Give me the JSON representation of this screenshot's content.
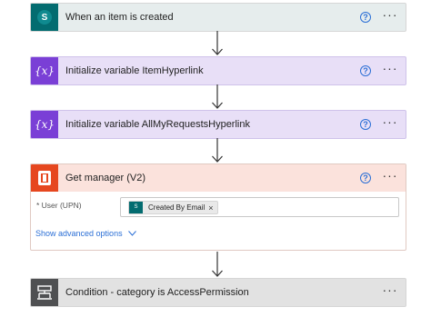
{
  "steps": [
    {
      "id": "trigger",
      "title": "When an item is created",
      "icon": "sharepoint-icon",
      "icon_letter": "S",
      "help": "?",
      "more": "···"
    },
    {
      "id": "init-item",
      "title": "Initialize variable ItemHyperlink",
      "icon": "variable-icon",
      "icon_text": "{x}",
      "help": "?",
      "more": "···"
    },
    {
      "id": "init-all",
      "title": "Initialize variable AllMyRequestsHyperlink",
      "icon": "variable-icon",
      "icon_text": "{x}",
      "help": "?",
      "more": "···"
    },
    {
      "id": "get-manager",
      "title": "Get manager (V2)",
      "icon": "office-icon",
      "help": "?",
      "more": "···",
      "fields": [
        {
          "label": "* User (UPN)",
          "token": "Created By Email",
          "token_remove": "×"
        }
      ],
      "advanced_label": "Show advanced options"
    },
    {
      "id": "condition",
      "title": "Condition - category is AccessPermission",
      "icon": "condition-icon",
      "more": "···"
    }
  ],
  "colors": {
    "sharepoint": "#036c70",
    "variable": "#7a3fd6",
    "office": "#e6471f",
    "condition": "#4f5052",
    "link": "#2b6fd6"
  }
}
